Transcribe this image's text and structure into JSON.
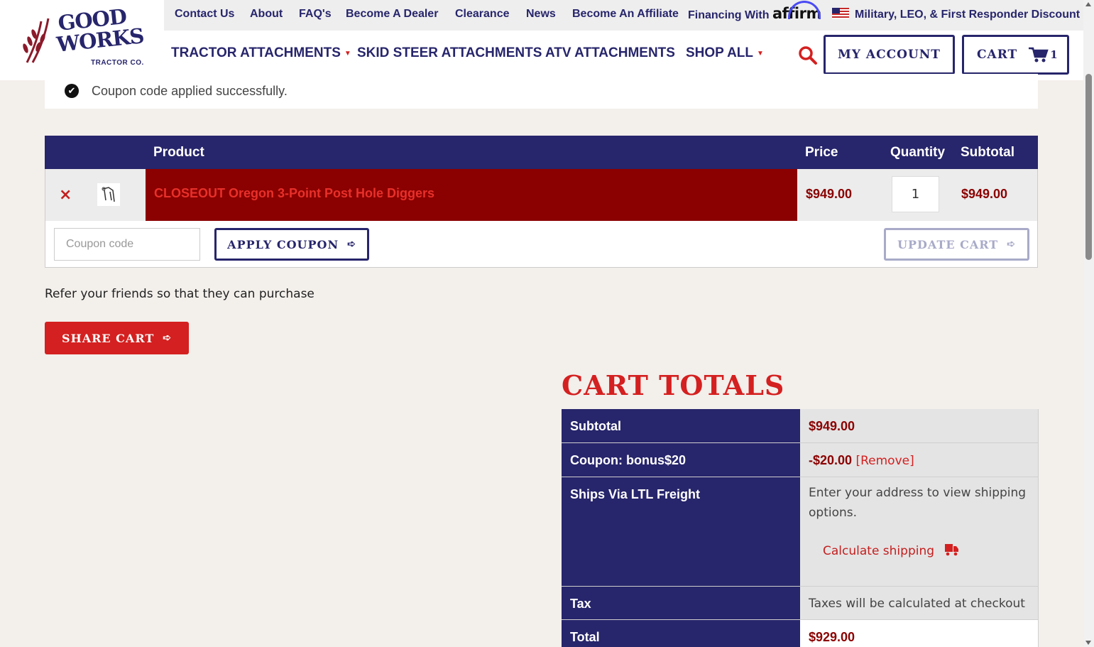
{
  "brand": {
    "line1": "GOOD",
    "line2": "WORKS",
    "line3": "TRACTOR CO."
  },
  "topbar": {
    "items": [
      "Contact Us",
      "About",
      "FAQ's",
      "Become A Dealer",
      "Clearance",
      "News",
      "Become An Affiliate"
    ],
    "financing_label": "Financing With",
    "affirm_word": "affirm",
    "discount_label": "Military, LEO, & First Responder Discount"
  },
  "mainnav": {
    "items": [
      "TRACTOR ATTACHMENTS",
      "SKID STEER ATTACHMENTS",
      "ATV ATTACHMENTS",
      "SHOP ALL"
    ]
  },
  "header_buttons": {
    "account": "MY ACCOUNT",
    "cart": "CART",
    "cart_count": "1"
  },
  "notice": {
    "message": "Coupon code applied successfully."
  },
  "cart_table": {
    "headers": {
      "product": "Product",
      "price": "Price",
      "quantity": "Quantity",
      "subtotal": "Subtotal"
    },
    "items": [
      {
        "name": "CLOSEOUT Oregon 3-Point Post Hole Diggers",
        "price": "$949.00",
        "quantity": "1",
        "subtotal": "$949.00"
      }
    ],
    "remove_symbol": "×"
  },
  "actions": {
    "coupon_placeholder": "Coupon code",
    "apply_coupon": "APPLY COUPON",
    "update_cart": "UPDATE CART"
  },
  "referral": {
    "text": "Refer your friends so that they can purchase",
    "share_button": "SHARE CART"
  },
  "totals": {
    "title": "CART TOTALS",
    "subtotal_label": "Subtotal",
    "subtotal_value": "$949.00",
    "coupon_label": "Coupon: bonus$20",
    "coupon_value": "-$20.00",
    "coupon_remove": "[Remove]",
    "shipping_label": "Ships Via LTL Freight",
    "shipping_text": "Enter your address to view shipping options.",
    "calc_shipping": "Calculate shipping",
    "tax_label": "Tax",
    "tax_value": "Taxes will be calculated at checkout",
    "total_label": "Total",
    "total_value": "$929.00"
  },
  "colors": {
    "navy": "#27256b",
    "red": "#d42020",
    "dark_red": "#8b0000"
  }
}
